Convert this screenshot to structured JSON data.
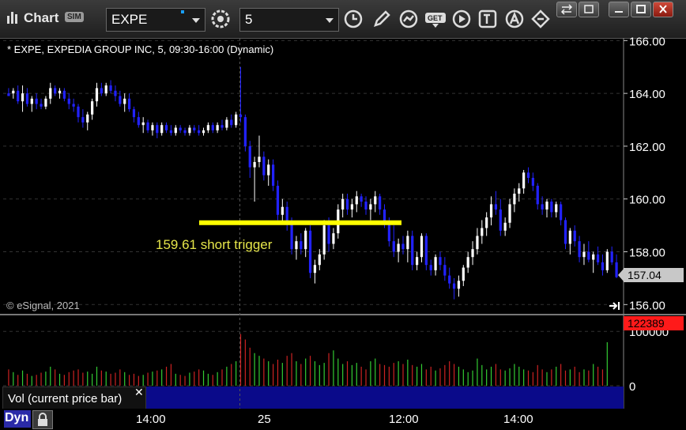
{
  "app": {
    "title": "Chart",
    "badge": "SIM"
  },
  "toolbar": {
    "symbol": "EXPE",
    "interval": "5",
    "icons": [
      "chart-settings-icon",
      "clock-icon",
      "pencil-draw-icon",
      "study-icon",
      "get-data-icon",
      "play-icon",
      "text-tool-icon",
      "alert-icon",
      "arrows-icon"
    ]
  },
  "window_controls": [
    "swap-icon",
    "restore-icon",
    "minimize-icon",
    "maximize-icon",
    "close-icon"
  ],
  "chart": {
    "header": "* EXPE, EXPEDIA GROUP INC, 5, 09:30-16:00 (Dynamic)",
    "copyright": "© eSignal, 2021",
    "annotation": "159.61 short trigger",
    "last_price": "157.04",
    "last_volume": "122389",
    "volume_label": "Vol (current price bar)",
    "bottom_mode": "Dyn",
    "colors": {
      "up_candle": "#ffffff",
      "down_candle": "#2222ff",
      "trigger_line": "#ffff00",
      "vol_up": "#33cc33",
      "vol_down": "#cc2222",
      "last_price_tag": "#c8c8c8",
      "volume_tag": "#ff1a1a"
    }
  },
  "chart_data": {
    "type": "candlestick",
    "price_axis": {
      "ticks": [
        "166.00",
        "164.00",
        "162.00",
        "160.00",
        "158.00",
        "156.00"
      ],
      "range": [
        155.65,
        166.1
      ]
    },
    "volume_axis": {
      "ticks": [
        "100000",
        "0"
      ],
      "range": [
        0,
        125000
      ]
    },
    "x_ticks": [
      "14:00",
      "25",
      "12:00",
      "14:00"
    ],
    "trigger_level": 159.1,
    "candles": [
      [
        164.0,
        164.2,
        163.9,
        163.9
      ],
      [
        164.0,
        164.2,
        163.8,
        164.1
      ],
      [
        164.1,
        164.3,
        163.6,
        163.7
      ],
      [
        163.7,
        164.3,
        163.3,
        164.0
      ],
      [
        164.0,
        164.2,
        163.5,
        163.6
      ],
      [
        163.6,
        163.9,
        163.3,
        163.8
      ],
      [
        163.8,
        164.0,
        163.4,
        163.6
      ],
      [
        163.6,
        163.8,
        163.4,
        163.5
      ],
      [
        163.5,
        163.9,
        163.4,
        163.8
      ],
      [
        163.8,
        164.4,
        163.6,
        164.2
      ],
      [
        164.2,
        164.3,
        163.9,
        164.0
      ],
      [
        164.0,
        164.2,
        163.8,
        164.1
      ],
      [
        164.1,
        164.2,
        163.7,
        163.8
      ],
      [
        163.8,
        164.0,
        163.4,
        163.6
      ],
      [
        163.6,
        163.8,
        163.3,
        163.5
      ],
      [
        163.5,
        163.6,
        162.9,
        163.1
      ],
      [
        163.1,
        163.4,
        162.7,
        162.9
      ],
      [
        162.9,
        163.3,
        162.6,
        163.2
      ],
      [
        163.2,
        163.8,
        163.0,
        163.7
      ],
      [
        163.7,
        164.4,
        163.5,
        164.2
      ],
      [
        164.2,
        164.4,
        163.9,
        164.0
      ],
      [
        164.0,
        164.4,
        163.9,
        164.3
      ],
      [
        164.3,
        164.5,
        164.0,
        164.1
      ],
      [
        164.1,
        164.3,
        163.7,
        163.9
      ],
      [
        163.9,
        164.1,
        163.5,
        163.6
      ],
      [
        163.6,
        164.0,
        163.3,
        163.8
      ],
      [
        163.8,
        164.0,
        163.3,
        163.4
      ],
      [
        163.4,
        163.5,
        162.9,
        163.1
      ],
      [
        163.1,
        163.3,
        162.7,
        162.8
      ],
      [
        162.8,
        163.1,
        162.5,
        162.9
      ],
      [
        162.9,
        163.0,
        162.5,
        162.6
      ],
      [
        162.6,
        162.9,
        162.4,
        162.8
      ],
      [
        162.8,
        162.9,
        162.3,
        162.5
      ],
      [
        162.5,
        162.9,
        162.4,
        162.8
      ],
      [
        162.8,
        162.9,
        162.5,
        162.6
      ],
      [
        162.6,
        162.8,
        162.4,
        162.5
      ],
      [
        162.5,
        162.8,
        162.4,
        162.7
      ],
      [
        162.7,
        162.8,
        162.5,
        162.6
      ],
      [
        162.6,
        162.7,
        162.4,
        162.5
      ],
      [
        162.5,
        162.8,
        162.4,
        162.7
      ],
      [
        162.7,
        162.8,
        162.5,
        162.6
      ],
      [
        162.6,
        162.8,
        162.4,
        162.5
      ],
      [
        162.5,
        162.7,
        162.4,
        162.6
      ],
      [
        162.6,
        162.9,
        162.5,
        162.8
      ],
      [
        162.8,
        162.9,
        162.5,
        162.6
      ],
      [
        162.6,
        162.9,
        162.5,
        162.8
      ],
      [
        162.8,
        163.0,
        162.6,
        162.7
      ],
      [
        162.7,
        163.1,
        162.6,
        163.0
      ],
      [
        163.0,
        163.2,
        162.7,
        162.8
      ],
      [
        162.8,
        163.3,
        162.7,
        163.2
      ],
      [
        163.2,
        165.0,
        162.9,
        163.1
      ],
      [
        163.1,
        163.2,
        161.8,
        162.0
      ],
      [
        162.0,
        162.2,
        160.8,
        161.2
      ],
      [
        161.2,
        161.6,
        159.9,
        161.4
      ],
      [
        161.4,
        162.4,
        161.2,
        161.6
      ],
      [
        161.6,
        161.8,
        160.7,
        160.9
      ],
      [
        160.9,
        161.5,
        160.5,
        161.3
      ],
      [
        161.3,
        161.5,
        160.3,
        160.5
      ],
      [
        160.5,
        160.7,
        159.2,
        159.4
      ],
      [
        159.4,
        160.0,
        159.1,
        159.7
      ],
      [
        159.7,
        159.9,
        158.8,
        159.1
      ],
      [
        159.1,
        159.3,
        157.9,
        158.1
      ],
      [
        158.1,
        158.6,
        157.7,
        158.4
      ],
      [
        158.4,
        158.7,
        157.9,
        158.1
      ],
      [
        158.1,
        158.9,
        157.8,
        158.8
      ],
      [
        158.8,
        159.0,
        157.0,
        157.2
      ],
      [
        157.2,
        157.7,
        156.8,
        157.5
      ],
      [
        157.5,
        158.1,
        157.3,
        157.9
      ],
      [
        157.9,
        159.2,
        157.7,
        159.0
      ],
      [
        159.0,
        159.3,
        158.0,
        158.3
      ],
      [
        158.3,
        158.9,
        158.1,
        158.7
      ],
      [
        158.7,
        159.8,
        158.5,
        159.6
      ],
      [
        159.6,
        160.2,
        159.3,
        160.0
      ],
      [
        160.0,
        160.2,
        159.4,
        159.6
      ],
      [
        159.6,
        160.0,
        159.3,
        159.8
      ],
      [
        159.8,
        160.3,
        159.5,
        160.1
      ],
      [
        160.1,
        160.2,
        159.7,
        159.9
      ],
      [
        159.9,
        160.1,
        159.4,
        159.6
      ],
      [
        159.6,
        160.0,
        159.2,
        159.8
      ],
      [
        159.8,
        160.3,
        159.5,
        160.1
      ],
      [
        160.1,
        160.2,
        159.4,
        159.6
      ],
      [
        159.6,
        159.8,
        158.9,
        159.1
      ],
      [
        159.1,
        159.3,
        158.2,
        158.4
      ],
      [
        158.4,
        159.0,
        157.8,
        158.0
      ],
      [
        158.0,
        158.5,
        157.6,
        158.3
      ],
      [
        158.3,
        158.6,
        157.9,
        158.1
      ],
      [
        158.1,
        158.8,
        157.6,
        158.6
      ],
      [
        158.6,
        158.8,
        157.3,
        157.5
      ],
      [
        157.5,
        158.0,
        157.3,
        157.8
      ],
      [
        157.8,
        158.7,
        157.6,
        158.6
      ],
      [
        158.6,
        158.7,
        157.3,
        157.5
      ],
      [
        157.5,
        157.7,
        157.1,
        157.3
      ],
      [
        157.3,
        157.9,
        157.1,
        157.8
      ],
      [
        157.8,
        158.0,
        157.3,
        157.5
      ],
      [
        157.5,
        157.8,
        156.9,
        157.1
      ],
      [
        157.1,
        157.4,
        156.6,
        156.8
      ],
      [
        156.8,
        157.0,
        156.2,
        156.6
      ],
      [
        156.6,
        157.1,
        156.3,
        156.9
      ],
      [
        156.9,
        157.5,
        156.7,
        157.4
      ],
      [
        157.4,
        158.0,
        157.2,
        157.8
      ],
      [
        157.8,
        158.4,
        157.5,
        158.1
      ],
      [
        158.1,
        158.9,
        157.9,
        158.6
      ],
      [
        158.6,
        159.2,
        158.3,
        158.9
      ],
      [
        158.9,
        159.5,
        158.6,
        159.3
      ],
      [
        159.3,
        160.1,
        159.0,
        159.8
      ],
      [
        159.8,
        160.3,
        159.4,
        159.6
      ],
      [
        159.6,
        160.0,
        158.6,
        158.8
      ],
      [
        158.8,
        159.3,
        158.6,
        159.1
      ],
      [
        159.1,
        160.0,
        158.9,
        159.8
      ],
      [
        159.8,
        160.4,
        159.5,
        160.2
      ],
      [
        160.2,
        160.6,
        159.9,
        160.4
      ],
      [
        160.4,
        161.1,
        160.2,
        161.0
      ],
      [
        161.0,
        161.2,
        160.6,
        160.8
      ],
      [
        160.8,
        161.0,
        160.3,
        160.5
      ],
      [
        160.5,
        160.6,
        159.6,
        159.8
      ],
      [
        159.8,
        160.1,
        159.4,
        159.6
      ],
      [
        159.6,
        160.0,
        159.3,
        159.9
      ],
      [
        159.9,
        160.0,
        159.3,
        159.5
      ],
      [
        159.5,
        159.9,
        159.3,
        159.8
      ],
      [
        159.8,
        159.9,
        159.0,
        159.2
      ],
      [
        159.2,
        159.3,
        158.1,
        158.3
      ],
      [
        158.3,
        158.9,
        157.9,
        158.8
      ],
      [
        158.8,
        159.0,
        158.2,
        158.4
      ],
      [
        158.4,
        158.6,
        157.6,
        157.8
      ],
      [
        157.8,
        158.3,
        157.5,
        158.0
      ],
      [
        158.0,
        158.4,
        157.6,
        157.7
      ],
      [
        157.7,
        158.0,
        157.2,
        157.9
      ],
      [
        157.9,
        158.2,
        157.5,
        157.6
      ],
      [
        157.6,
        157.9,
        157.1,
        157.3
      ],
      [
        157.3,
        158.1,
        157.2,
        158.0
      ],
      [
        158.0,
        158.2,
        157.5,
        157.6
      ],
      [
        157.6,
        157.9,
        157.0,
        157.04
      ]
    ],
    "volume": [
      30,
      25,
      20,
      28,
      22,
      18,
      20,
      24,
      26,
      35,
      30,
      22,
      20,
      25,
      28,
      30,
      24,
      26,
      22,
      35,
      28,
      26,
      22,
      24,
      30,
      25,
      20,
      22,
      18,
      20,
      24,
      26,
      28,
      30,
      35,
      40,
      22,
      20,
      18,
      24,
      26,
      30,
      28,
      22,
      20,
      25,
      30,
      35,
      40,
      45,
      95,
      85,
      70,
      60,
      55,
      50,
      45,
      40,
      48,
      42,
      55,
      60,
      45,
      40,
      50,
      55,
      45,
      38,
      42,
      60,
      65,
      50,
      40,
      45,
      38,
      42,
      35,
      30,
      45,
      50,
      40,
      38,
      35,
      42,
      45,
      40,
      48,
      38,
      35,
      40,
      30,
      35,
      28,
      32,
      38,
      45,
      40,
      35,
      30,
      25,
      28,
      50,
      38,
      30,
      35,
      40,
      30,
      28,
      32,
      40,
      35,
      30,
      28,
      25,
      38,
      30,
      25,
      30,
      35,
      40,
      28,
      30,
      35,
      25,
      30,
      28,
      40,
      35,
      30,
      80
    ]
  }
}
